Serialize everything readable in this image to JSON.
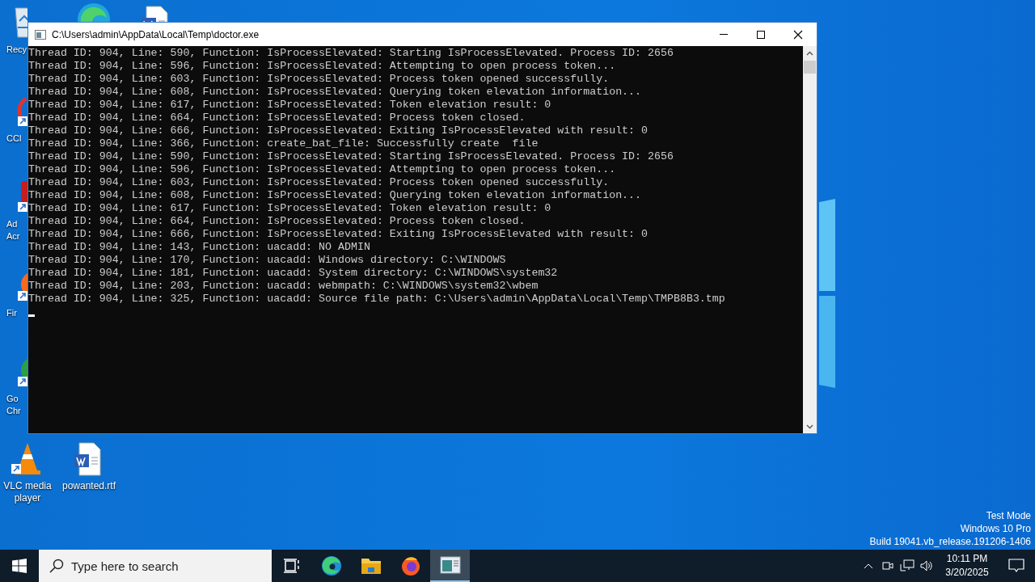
{
  "desktop": {
    "icons": [
      {
        "kind": "recycle-bin",
        "label": [
          "Recy"
        ]
      },
      {
        "kind": "edge"
      },
      {
        "kind": "word-document"
      },
      {
        "kind": "cleaner",
        "label": [
          "CCl"
        ]
      },
      {
        "kind": "pdf",
        "label": [
          "Ad",
          "Acr"
        ]
      },
      {
        "kind": "firefox",
        "label": [
          "Fir"
        ]
      },
      {
        "kind": "chrome",
        "label": [
          "Go",
          "Chr"
        ]
      },
      {
        "kind": "vlc",
        "label": [
          "VLC media",
          "player"
        ]
      },
      {
        "kind": "word-document",
        "label": [
          "powanted.rtf"
        ]
      }
    ],
    "watermark_text": [
      "Test Mode",
      "Windows 10 Pro",
      "Build 19041.vb_release.191206-1406"
    ]
  },
  "window": {
    "title": "C:\\Users\\admin\\AppData\\Local\\Temp\\doctor.exe",
    "lines": [
      "Thread ID: 904, Line: 590, Function: IsProcessElevated: Starting IsProcessElevated. Process ID: 2656",
      "Thread ID: 904, Line: 596, Function: IsProcessElevated: Attempting to open process token...",
      "Thread ID: 904, Line: 603, Function: IsProcessElevated: Process token opened successfully.",
      "Thread ID: 904, Line: 608, Function: IsProcessElevated: Querying token elevation information...",
      "Thread ID: 904, Line: 617, Function: IsProcessElevated: Token elevation result: 0",
      "Thread ID: 904, Line: 664, Function: IsProcessElevated: Process token closed.",
      "Thread ID: 904, Line: 666, Function: IsProcessElevated: Exiting IsProcessElevated with result: 0",
      "Thread ID: 904, Line: 366, Function: create_bat_file: Successfully create  file",
      "Thread ID: 904, Line: 590, Function: IsProcessElevated: Starting IsProcessElevated. Process ID: 2656",
      "Thread ID: 904, Line: 596, Function: IsProcessElevated: Attempting to open process token...",
      "Thread ID: 904, Line: 603, Function: IsProcessElevated: Process token opened successfully.",
      "Thread ID: 904, Line: 608, Function: IsProcessElevated: Querying token elevation information...",
      "Thread ID: 904, Line: 617, Function: IsProcessElevated: Token elevation result: 0",
      "Thread ID: 904, Line: 664, Function: IsProcessElevated: Process token closed.",
      "Thread ID: 904, Line: 666, Function: IsProcessElevated: Exiting IsProcessElevated with result: 0",
      "Thread ID: 904, Line: 143, Function: uacadd: NO ADMIN",
      "Thread ID: 904, Line: 170, Function: uacadd: Windows directory: C:\\WINDOWS",
      "Thread ID: 904, Line: 181, Function: uacadd: System directory: C:\\WINDOWS\\system32",
      "Thread ID: 904, Line: 203, Function: uacadd: webmpath: C:\\WINDOWS\\system32\\wbem",
      "Thread ID: 904, Line: 325, Function: uacadd: Source file path: C:\\Users\\admin\\AppData\\Local\\Temp\\TMPB8B3.tmp"
    ]
  },
  "taskbar": {
    "search": {
      "placeholder": "Type here to search"
    },
    "apps": [
      {
        "kind": "task-view",
        "selected": false
      },
      {
        "kind": "edge",
        "selected": false
      },
      {
        "kind": "explorer",
        "selected": false
      },
      {
        "kind": "firefox",
        "selected": false
      },
      {
        "kind": "console",
        "selected": true
      }
    ],
    "tray": {
      "time": "10:11 PM",
      "date": "3/20/2025"
    }
  }
}
